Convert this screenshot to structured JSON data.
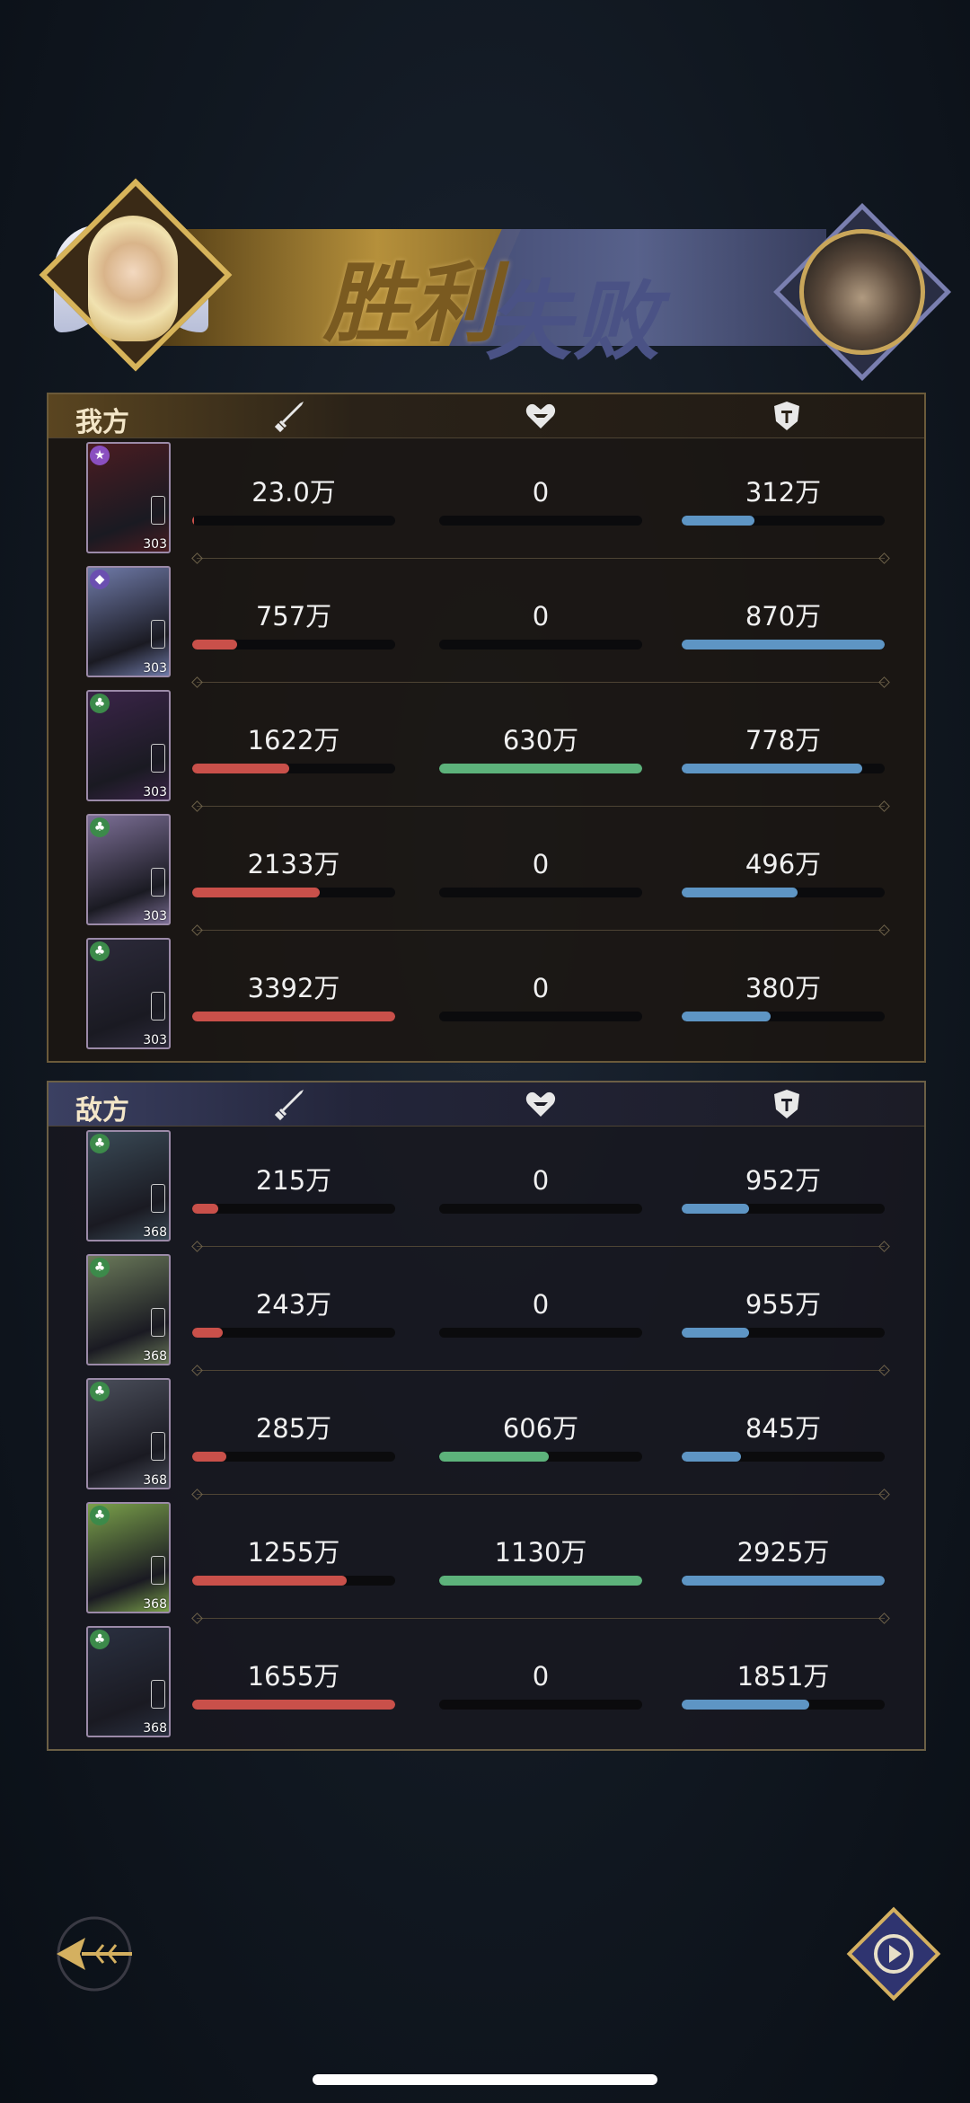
{
  "banner": {
    "victory_text": "胜利",
    "defeat_text": "失败"
  },
  "teams": [
    {
      "title": "我方",
      "rows": [
        {
          "atk": "23.0万",
          "atk_pct": 0.01,
          "heal": "0",
          "heal_pct": 0,
          "def": "312万",
          "def_pct": 0.36,
          "level": "303",
          "badge": "★",
          "badge_color": "#8a4fc0",
          "card_bg": "#4a1c22"
        },
        {
          "atk": "757万",
          "atk_pct": 0.22,
          "heal": "0",
          "heal_pct": 0,
          "def": "870万",
          "def_pct": 1.0,
          "level": "303",
          "badge": "◆",
          "badge_color": "#6b4fb0",
          "card_bg": "#6f7aa8"
        },
        {
          "atk": "1622万",
          "atk_pct": 0.48,
          "heal": "630万",
          "heal_pct": 1.0,
          "def": "778万",
          "def_pct": 0.89,
          "level": "303",
          "badge": "♣",
          "badge_color": "#3c8a4a",
          "card_bg": "#3a2448"
        },
        {
          "atk": "2133万",
          "atk_pct": 0.63,
          "heal": "0",
          "heal_pct": 0,
          "def": "496万",
          "def_pct": 0.57,
          "level": "303",
          "badge": "♣",
          "badge_color": "#3c8a4a",
          "card_bg": "#7c6f96"
        },
        {
          "atk": "3392万",
          "atk_pct": 1.0,
          "heal": "0",
          "heal_pct": 0,
          "def": "380万",
          "def_pct": 0.44,
          "level": "303",
          "badge": "♣",
          "badge_color": "#3c8a4a",
          "card_bg": "#2c2a3a"
        }
      ]
    },
    {
      "title": "敌方",
      "rows": [
        {
          "atk": "215万",
          "atk_pct": 0.13,
          "heal": "0",
          "heal_pct": 0,
          "def": "952万",
          "def_pct": 0.33,
          "level": "368",
          "badge": "♣",
          "badge_color": "#3c8a4a",
          "card_bg": "#3a4a56"
        },
        {
          "atk": "243万",
          "atk_pct": 0.15,
          "heal": "0",
          "heal_pct": 0,
          "def": "955万",
          "def_pct": 0.33,
          "level": "368",
          "badge": "♣",
          "badge_color": "#3c8a4a",
          "card_bg": "#6b7a5a"
        },
        {
          "atk": "285万",
          "atk_pct": 0.17,
          "heal": "606万",
          "heal_pct": 0.54,
          "def": "845万",
          "def_pct": 0.29,
          "level": "368",
          "badge": "♣",
          "badge_color": "#3c8a4a",
          "card_bg": "#4a4e5a"
        },
        {
          "atk": "1255万",
          "atk_pct": 0.76,
          "heal": "1130万",
          "heal_pct": 1.0,
          "def": "2925万",
          "def_pct": 1.0,
          "level": "368",
          "badge": "♣",
          "badge_color": "#3c8a4a",
          "card_bg": "#7aa04a"
        },
        {
          "atk": "1655万",
          "atk_pct": 1.0,
          "heal": "0",
          "heal_pct": 0,
          "def": "1851万",
          "def_pct": 0.63,
          "level": "368",
          "badge": "♣",
          "badge_color": "#3c8a4a",
          "card_bg": "#2a3040"
        }
      ]
    }
  ],
  "icons": {
    "attack": "sword-icon",
    "heal": "heart-icon",
    "defense": "shield-icon",
    "back": "back-arrow-icon",
    "replay": "replay-icon"
  }
}
